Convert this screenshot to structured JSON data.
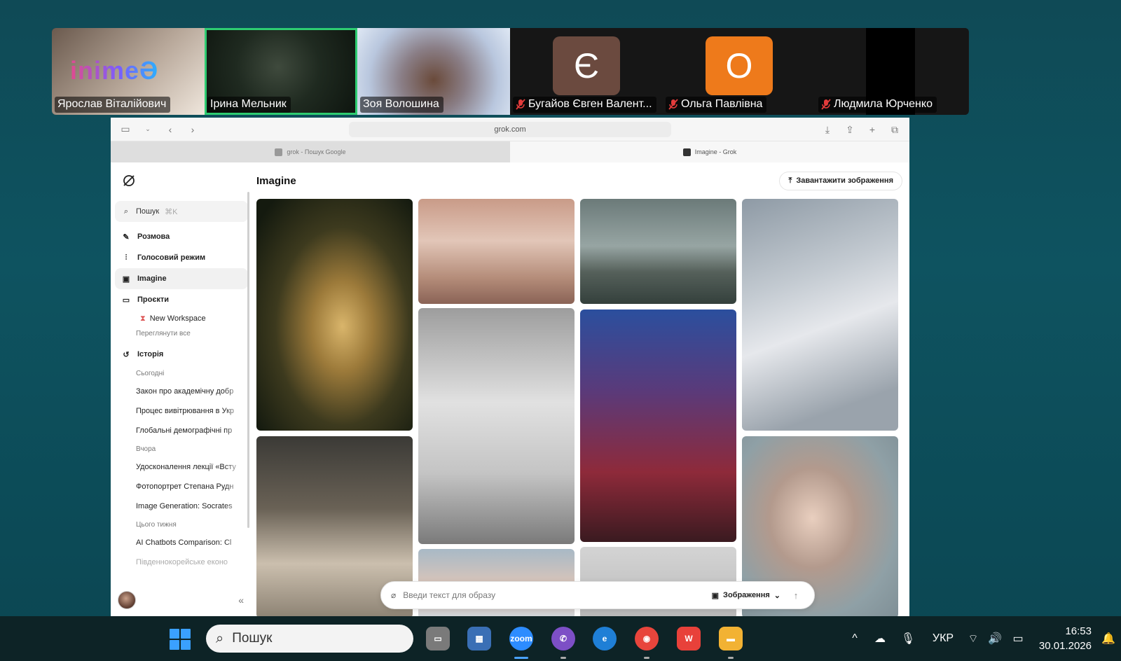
{
  "participants": [
    {
      "name": "Ярослав Віталійович",
      "muted": false,
      "overlay_text": "inimeƏ"
    },
    {
      "name": "Ірина Мельник",
      "muted": false,
      "active_speaker": true
    },
    {
      "name": "Зоя Волошина",
      "muted": false
    },
    {
      "name": "Бугайов Євген Валент...",
      "muted": true,
      "initial": "Є",
      "color": "#6b4a3f"
    },
    {
      "name": "Ольга Павлівна",
      "muted": true,
      "initial": "О",
      "color": "#ee7a1b"
    },
    {
      "name": "Людмила Юрченко",
      "muted": true
    }
  ],
  "browser": {
    "url": "grok.com",
    "tabs": [
      {
        "title": "grok - Пошук Google",
        "active": false
      },
      {
        "title": "Imagine - Grok",
        "active": true
      }
    ]
  },
  "sidebar": {
    "search_label": "Пошук",
    "search_shortcut": "⌘K",
    "items": [
      {
        "label": "Розмова",
        "icon": "edit-icon"
      },
      {
        "label": "Голосовий режим",
        "icon": "waveform-icon"
      },
      {
        "label": "Imagine",
        "icon": "image-icon",
        "selected": true
      },
      {
        "label": "Проєкти",
        "icon": "folder-icon"
      }
    ],
    "project": "New Workspace",
    "view_all": "Переглянути все",
    "history_label": "Історія",
    "history_groups": [
      {
        "label": "Сьогодні",
        "items": [
          "Закон про академічну добр",
          "Процес вивітрювання в Укр",
          "Глобальні демографічні пр"
        ]
      },
      {
        "label": "Вчора",
        "items": [
          "Удосконалення лекції «Всту",
          "Фотопортрет Степана Рудн",
          "Image Generation: Socrates"
        ]
      },
      {
        "label": "Цього тижня",
        "items": [
          "AI Chatbots Comparison: Cl",
          "Південнокорейське еконо"
        ]
      }
    ]
  },
  "main": {
    "title": "Imagine",
    "upload_button": "Завантажити зображення",
    "prompt_placeholder": "Введи текст для образу",
    "mode_label": "Зображення"
  },
  "taskbar": {
    "search_placeholder": "Пошук",
    "language": "УКР",
    "time": "16:53",
    "date": "30.01.2026",
    "zoom_label": "zoom"
  }
}
